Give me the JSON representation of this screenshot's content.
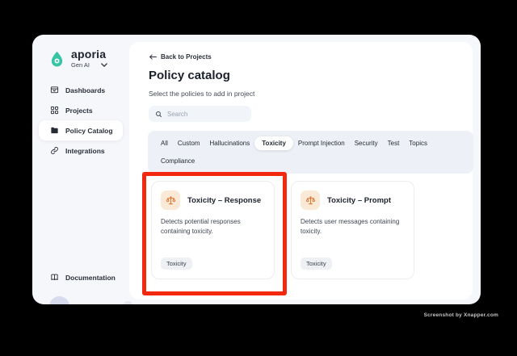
{
  "colors": {
    "brand_teal": "#35C4A4",
    "annotation_red": "#F2290E",
    "card_icon_orange": "#E2772F",
    "card_icon_bg": "#FBE9D8"
  },
  "sidebar": {
    "brand": "aporia",
    "workspace": "Gen AI",
    "items": [
      {
        "label": "Dashboards"
      },
      {
        "label": "Projects"
      },
      {
        "label": "Policy Catalog",
        "active": true
      },
      {
        "label": "Integrations"
      }
    ],
    "footer_item": {
      "label": "Documentation"
    }
  },
  "header": {
    "back_label": "Back to Projects",
    "title": "Policy catalog",
    "subtitle": "Select the policies to add in project"
  },
  "search": {
    "placeholder": "Search"
  },
  "tabs": {
    "selected": "Toxicity",
    "items": [
      "All",
      "Custom",
      "Hallucinations",
      "Toxicity",
      "Prompt Injection",
      "Security",
      "Test",
      "Topics",
      "Compliance"
    ]
  },
  "cards": [
    {
      "title": "Toxicity – Response",
      "description": "Detects potential responses containing toxicity.",
      "tag": "Toxicity",
      "icon": "scales-icon"
    },
    {
      "title": "Toxicity – Prompt",
      "description": "Detects user messages containing toxicity.",
      "tag": "Toxicity",
      "icon": "scales-icon"
    }
  ],
  "watermark": "Screenshot by Xnapper.com"
}
